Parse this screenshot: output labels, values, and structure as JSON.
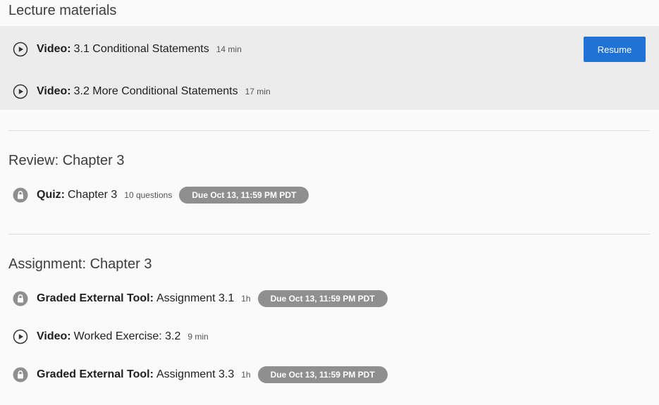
{
  "sections": [
    {
      "title": "Lecture materials",
      "items": [
        {
          "type": "Video:",
          "name": "3.1 Conditional Statements",
          "meta": "14 min",
          "icon": "play-icon",
          "action": "Resume"
        },
        {
          "type": "Video:",
          "name": "3.2 More Conditional Statements",
          "meta": "17 min",
          "icon": "play-icon"
        }
      ]
    },
    {
      "title": "Review: Chapter 3",
      "items": [
        {
          "type": "Quiz:",
          "name": "Chapter 3",
          "meta": "10 questions",
          "icon": "lock-icon",
          "due": "Due Oct 13, 11:59 PM PDT"
        }
      ]
    },
    {
      "title": "Assignment: Chapter 3",
      "items": [
        {
          "type": "Graded External Tool:",
          "name": "Assignment 3.1",
          "meta": "1h",
          "icon": "lock-icon",
          "due": "Due Oct 13, 11:59 PM PDT"
        },
        {
          "type": "Video:",
          "name": "Worked Exercise: 3.2",
          "meta": "9 min",
          "icon": "play-icon"
        },
        {
          "type": "Graded External Tool:",
          "name": "Assignment 3.3",
          "meta": "1h",
          "icon": "lock-icon",
          "due": "Due Oct 13, 11:59 PM PDT"
        }
      ]
    }
  ],
  "colors": {
    "accent": "#1f73d7",
    "badge": "#8f8f8f",
    "highlight": "#ececec",
    "background": "#fafafa"
  }
}
